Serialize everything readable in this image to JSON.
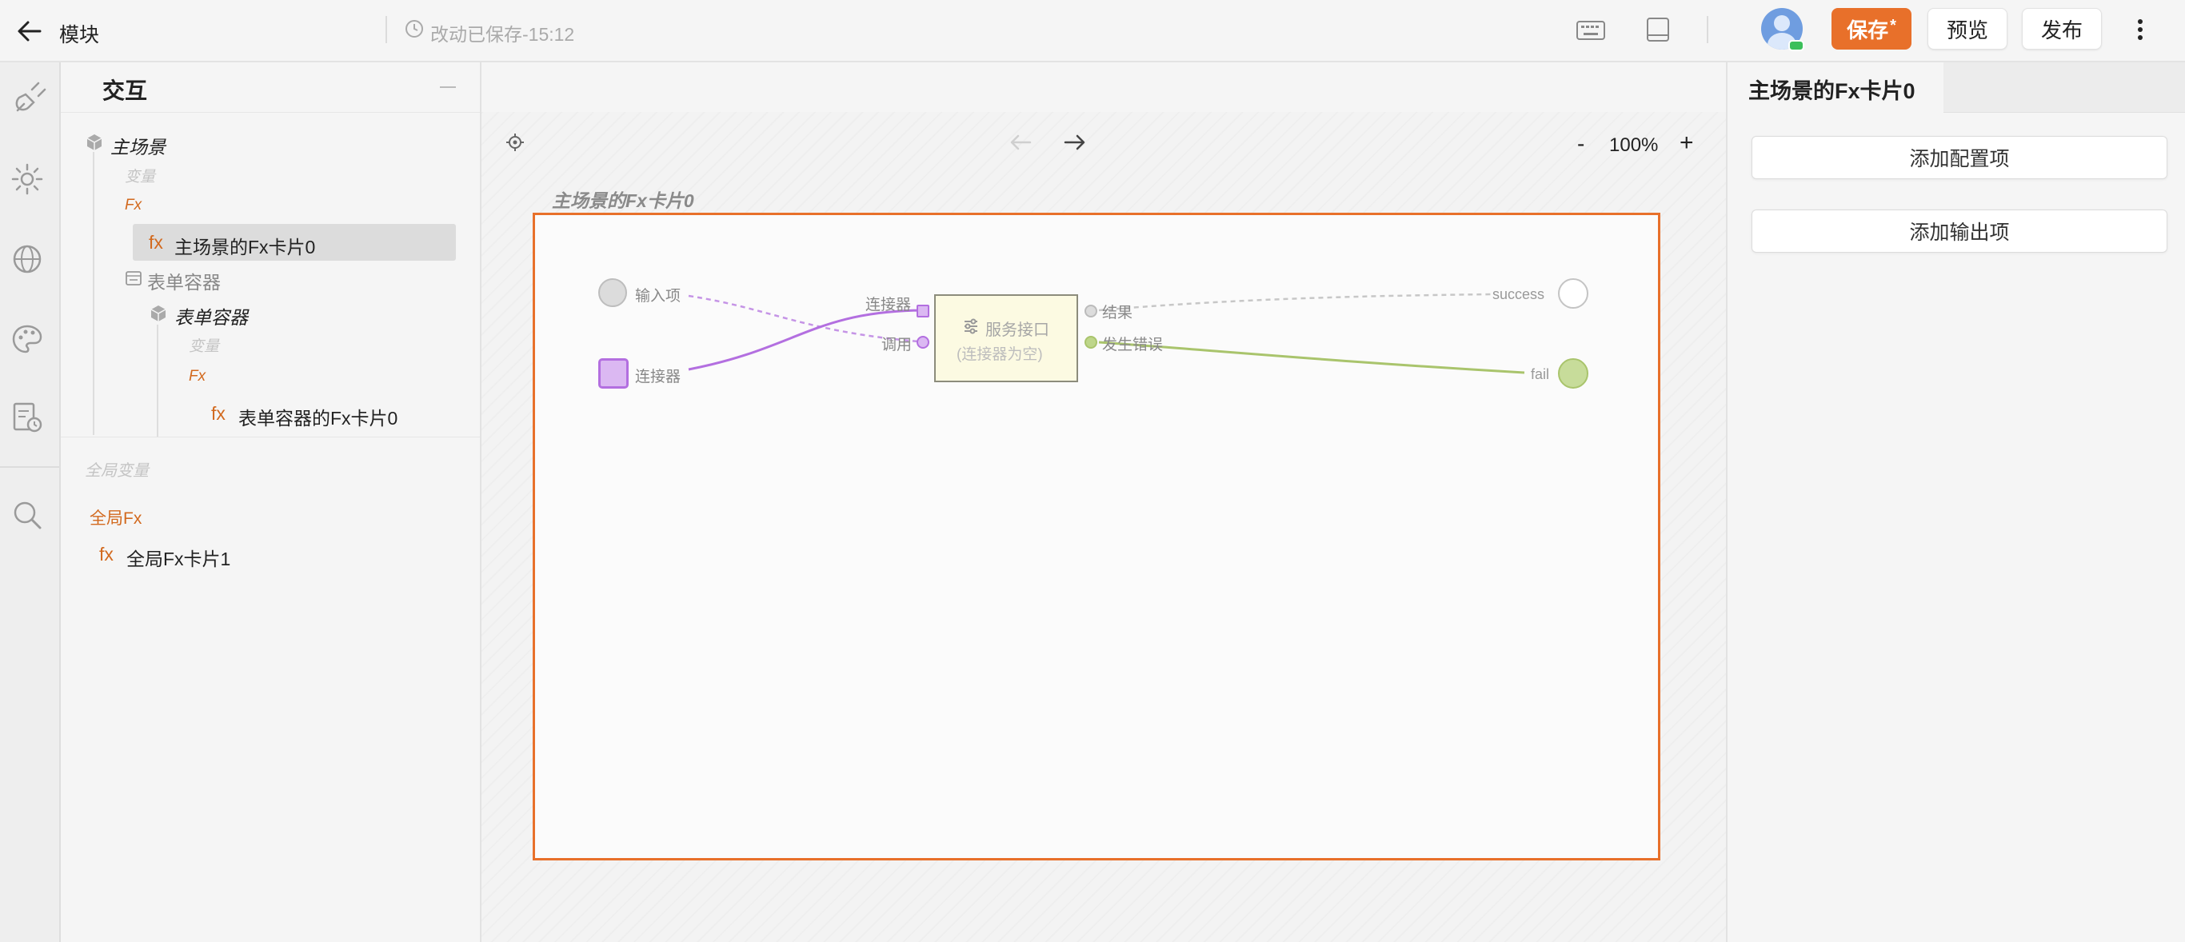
{
  "header": {
    "back_title": "模块",
    "save_status": "改动已保存-15:12",
    "save_label": "保存",
    "save_marker": "*",
    "preview_label": "预览",
    "publish_label": "发布"
  },
  "left_panel": {
    "title": "交互",
    "tree": {
      "main_scene": "主场景",
      "variables": "变量",
      "fx": "Fx",
      "main_fx_card": "主场景的Fx卡片0",
      "form_container_plain": "表单容器",
      "form_container": "表单容器",
      "form_variables": "变量",
      "form_fx": "Fx",
      "form_fx_card": "表单容器的Fx卡片0",
      "fx_prefix": "fx"
    },
    "global_vars": "全局变量",
    "global_fx": "全局Fx",
    "global_fx_card": "全局Fx卡片1"
  },
  "canvas": {
    "zoom": "100%",
    "zoom_minus": "-",
    "zoom_plus": "+",
    "card_title": "主场景的Fx卡片0",
    "nodes": {
      "input_label": "输入项",
      "connector_label": "连接器",
      "service_name": "服务接口",
      "service_sub": "(连接器为空)",
      "port_connector": "连接器",
      "port_invoke": "调用",
      "port_result": "结果",
      "port_error": "发生错误",
      "success_label": "success",
      "fail_label": "fail"
    }
  },
  "right_panel": {
    "tab_title": "主场景的Fx卡片0",
    "add_config": "添加配置项",
    "add_output": "添加输出项"
  },
  "colors": {
    "accent_orange": "#e8702a",
    "purple": "#b36fe0",
    "green": "#a9c46c"
  }
}
